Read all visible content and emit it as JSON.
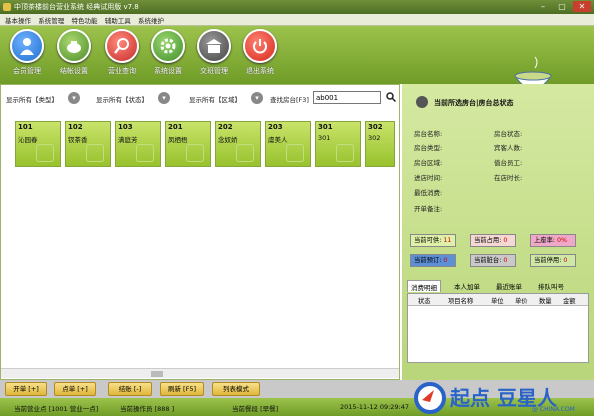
{
  "window": {
    "title": "中顶茶楼前台营业系统 经典试用版 v7.8",
    "min": "–",
    "max": "▢",
    "close": "✕"
  },
  "menu": [
    "基本操作",
    "系统管理",
    "特色功能",
    "辅助工具",
    "系统维护"
  ],
  "toolbar": [
    {
      "label": "会员管理",
      "icon": "member-icon",
      "color": "#1f6fd0"
    },
    {
      "label": "结帐设置",
      "icon": "teapot-icon",
      "color": "#4d8d2a"
    },
    {
      "label": "营业查询",
      "icon": "magnifier-icon",
      "color": "#c72c2c"
    },
    {
      "label": "系统设置",
      "icon": "gear-icon",
      "color": "#3f8f2f"
    },
    {
      "label": "交班管理",
      "icon": "building-icon",
      "color": "#555555"
    },
    {
      "label": "退出系统",
      "icon": "power-icon",
      "color": "#d42a1d"
    }
  ],
  "filters": {
    "type_label": "显示所有【类型】",
    "status_label": "显示所有【状态】",
    "area_label": "显示所有【区域】",
    "search_label": "查找房台[F3]",
    "search_value": "ab001"
  },
  "rooms": [
    {
      "num": "101",
      "name": "沁园春"
    },
    {
      "num": "102",
      "name": "钗茶香"
    },
    {
      "num": "103",
      "name": "满庭芳"
    },
    {
      "num": "201",
      "name": "凤栖梧"
    },
    {
      "num": "202",
      "name": "念奴娇"
    },
    {
      "num": "203",
      "name": "虞美人"
    },
    {
      "num": "301",
      "name": "301"
    },
    {
      "num": "302",
      "name": "302"
    }
  ],
  "right": {
    "title": "当前所选房台|房台总状态",
    "info_left": [
      "房台名称:",
      "房台类型:",
      "房台区域:",
      "进店时间:",
      "最低消费:",
      "开单备注:"
    ],
    "info_right": [
      "房台状态:",
      "宾客人数:",
      "值台员工:",
      "在店时长:"
    ],
    "stats": [
      {
        "label": "当前可供:",
        "value": "11",
        "color": "#dff0a8"
      },
      {
        "label": "当前占用:",
        "value": "0",
        "color": "#f5d8d3"
      },
      {
        "label": "上座率:",
        "value": "0%",
        "color": "#f0a8c8"
      },
      {
        "label": "当前预订:",
        "value": "0",
        "color": "#5c8fd6"
      },
      {
        "label": "当前脏台:",
        "value": "0",
        "color": "#c9c9c9"
      },
      {
        "label": "当前停用:",
        "value": "0",
        "color": "#cfe8a6"
      }
    ],
    "tabs": [
      "消费明细",
      "本人加单",
      "最近账单",
      "排队叫号"
    ],
    "columns": [
      "状态",
      "项目名称",
      "单位",
      "单价",
      "数量",
      "金额"
    ]
  },
  "buttons": [
    "开单 [+]",
    "点单 [+]",
    "结账 [-]",
    "刷新 [F5]",
    "列表模式"
  ],
  "status": {
    "shop": "当前营业点 [1001 营业一点]",
    "operator": "当前操作员 [888 ]",
    "shift": "当前餐段 [早餐]",
    "time": "2015-11-12 09:29:47"
  },
  "watermark": {
    "text": "起点 豆星人",
    "sub": "@ CHINA.COM"
  }
}
